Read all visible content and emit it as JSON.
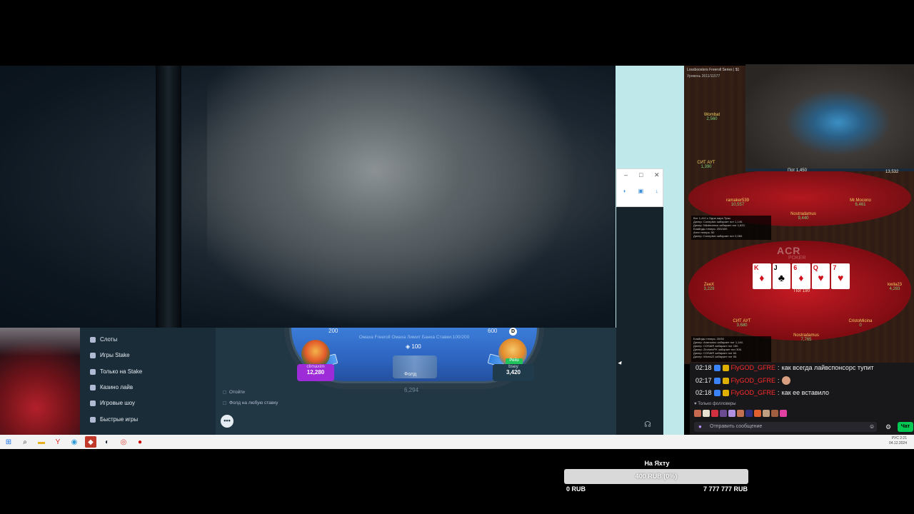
{
  "stake": {
    "sidebar": [
      {
        "label": "Слоты",
        "icon": "slots-icon"
      },
      {
        "label": "Игры Stake",
        "icon": "stake-games-icon"
      },
      {
        "label": "Только на Stake",
        "icon": "exclusive-icon"
      },
      {
        "label": "Казино лайв",
        "icon": "live-casino-icon"
      },
      {
        "label": "Игровые шоу",
        "icon": "game-shows-icon"
      },
      {
        "label": "Быстрые игры",
        "icon": "fast-games-icon"
      }
    ],
    "table_info": "Омаха Freeroll Омаха Лимит Банка Ставки:100/200",
    "blind_left": "200",
    "blind_right": "600",
    "dealer": "D",
    "pot": "100",
    "player1": {
      "name": "climaxim",
      "stack": "12,280"
    },
    "player2": {
      "name": "bsey",
      "stack": "3,420",
      "tag": "Рейз"
    },
    "player3": {
      "action": "Фолд",
      "stack": "6,294"
    },
    "options": [
      "Отойти",
      "Фолд на любую ставку"
    ]
  },
  "overlay": {
    "tourney_title": "Lossboosters Freeroll Series | $1",
    "tourney_info": "Уровень 2611/11577",
    "acr_logo": "ACR",
    "acr_sub": "POKER",
    "t1_pot": "Пот 1,450",
    "t2_pot": "Пот 190",
    "right_chips": "13,532",
    "board": [
      {
        "rank": "K",
        "suit": "♦",
        "red": true
      },
      {
        "rank": "J",
        "suit": "♣",
        "red": false
      },
      {
        "rank": "6",
        "suit": "♦",
        "red": true
      },
      {
        "rank": "Q",
        "suit": "♥",
        "red": true
      },
      {
        "rank": "7",
        "suit": "♥",
        "red": true
      }
    ],
    "seats": [
      {
        "name": "Wombat",
        "stack": "2,560"
      },
      {
        "name": "СИТ АУТ",
        "stack": "1,390"
      },
      {
        "name": "ramaker539",
        "stack": "10,557"
      },
      {
        "name": "Nostradamus",
        "stack": "9,440"
      },
      {
        "name": "Mr.Mocono",
        "stack": "6,461"
      },
      {
        "name": "ZeeX",
        "stack": "3,229"
      },
      {
        "name": "СИТ АУТ",
        "stack": "3,680"
      },
      {
        "name": "Nostradamus",
        "stack": "7,765"
      },
      {
        "name": "CristoMicina",
        "stack": "0"
      },
      {
        "name": "kwila23",
        "stack": "4,283"
      }
    ],
    "log1": [
      "Вот 1,410 с Одна пара Тузы",
      "Дилер: Conepisin забирает пот 1,140.",
      "Дилер: Nikdreamus забирает пот 1,620.",
      "Блайнды теперь: 200/400",
      "Анте теперь: 50",
      "Дилер: Conepisin забирает пот 2,060."
    ],
    "log2": [
      "Блайнды теперь: 20/50",
      "Дилер: Aramarino забирает пот 1,140.",
      "Дилер: COSAIR забирает пот 150.",
      "Дилер: ZIrcheinPK забирает пот 306.",
      "Дилер: COSAIR забирает пот 60.",
      "Дилер: Wixes22 забирает пот 55."
    ]
  },
  "chat": {
    "messages": [
      {
        "time": "02:18",
        "user": "FlyGOD_GFRE",
        "text": "как всегда лайвспонсорс тупит"
      },
      {
        "time": "02:17",
        "user": "FlyGOD_GFRE",
        "text": ""
      },
      {
        "time": "02:18",
        "user": "FlyGOD_GFRE",
        "text": "как ее вставило"
      }
    ],
    "followers_only": "Только фолловеры",
    "input_placeholder": "Отправить сообщение",
    "chat_button": "Чат"
  },
  "tray": {
    "line1": "РУС  2:21",
    "line2": "04.12.2024"
  },
  "goal": {
    "title": "На Яхту",
    "progress_text": "400 RUB (0%)",
    "progress_fraction": 0.0,
    "min": "0 RUB",
    "max": "7 777 777 RUB"
  },
  "colors": {
    "stake_bg": "#213743",
    "stake_sidebar": "#1a2c38",
    "raise_purple": "#9e2bd8",
    "chat_user": "#ff2a2a",
    "chat_btn": "#00c853"
  }
}
